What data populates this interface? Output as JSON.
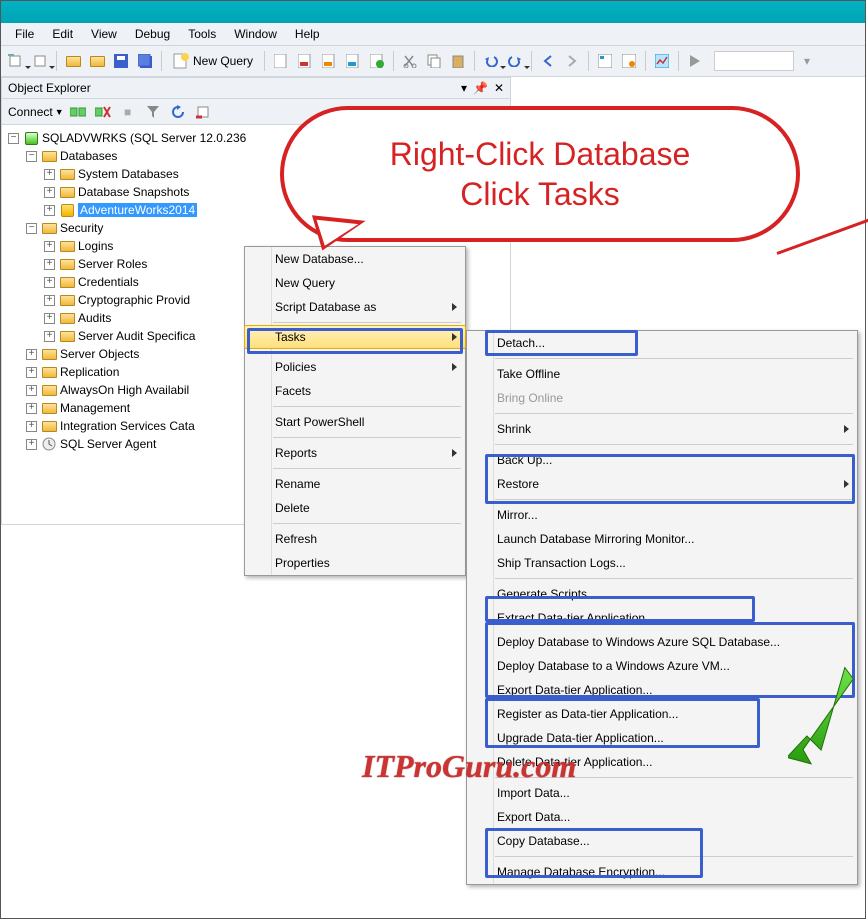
{
  "menubar": [
    "File",
    "Edit",
    "View",
    "Debug",
    "Tools",
    "Window",
    "Help"
  ],
  "toolbar": {
    "new_query": "New Query"
  },
  "explorer": {
    "title": "Object Explorer",
    "connect": "Connect",
    "server": "SQLADVWRKS (SQL Server 12.0.236",
    "nodes": {
      "databases": "Databases",
      "sysdb": "System Databases",
      "snap": "Database Snapshots",
      "aw": "AdventureWorks2014",
      "security": "Security",
      "logins": "Logins",
      "serverroles": "Server Roles",
      "creds": "Credentials",
      "crypto": "Cryptographic Provid",
      "audits": "Audits",
      "sas": "Server Audit Specifica",
      "srvobj": "Server Objects",
      "repl": "Replication",
      "alwayson": "AlwaysOn High Availabil",
      "mgmt": "Management",
      "isc": "Integration Services Cata",
      "agent": "SQL Server Agent"
    }
  },
  "ctx1": {
    "newdb": "New Database...",
    "newq": "New Query",
    "script": "Script Database as",
    "tasks": "Tasks",
    "policies": "Policies",
    "facets": "Facets",
    "ps": "Start PowerShell",
    "reports": "Reports",
    "rename": "Rename",
    "delete": "Delete",
    "refresh": "Refresh",
    "props": "Properties"
  },
  "ctx2": {
    "detach": "Detach...",
    "offline": "Take Offline",
    "online": "Bring Online",
    "shrink": "Shrink",
    "backup": "Back Up...",
    "restore": "Restore",
    "mirror": "Mirror...",
    "launchm": "Launch Database Mirroring Monitor...",
    "ship": "Ship Transaction Logs...",
    "gen": "Generate Scripts...",
    "extract": "Extract Data-tier Application...",
    "deploy1": "Deploy Database to Windows Azure SQL Database...",
    "deploy2": "Deploy Database to a Windows Azure VM...",
    "export_dt": "Export Data-tier Application...",
    "register": "Register as Data-tier Application...",
    "upgrade": "Upgrade Data-tier Application...",
    "delete_dt": "Delete Data-tier Application...",
    "import": "Import Data...",
    "export": "Export Data...",
    "copy": "Copy Database...",
    "encrypt": "Manage Database Encryption..."
  },
  "callout": "Right-Click Database\nClick Tasks",
  "watermark": "ITProGuru.com"
}
